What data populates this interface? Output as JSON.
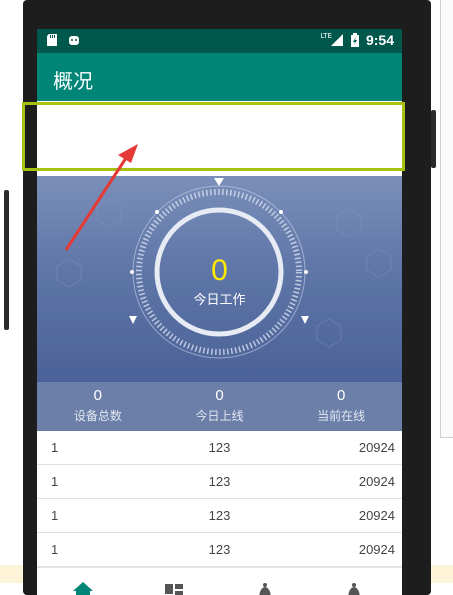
{
  "status_bar": {
    "network": "LTE",
    "time": "9:54"
  },
  "app_bar": {
    "title": "概况"
  },
  "gauge": {
    "value": "0",
    "label": "今日工作"
  },
  "stats": [
    {
      "value": "0",
      "label": "设备总数"
    },
    {
      "value": "0",
      "label": "今日上线"
    },
    {
      "value": "0",
      "label": "当前在线"
    }
  ],
  "rows": [
    {
      "c1": "1",
      "c2": "123",
      "c3": "20924"
    },
    {
      "c1": "1",
      "c2": "123",
      "c3": "20924"
    },
    {
      "c1": "1",
      "c2": "123",
      "c3": "20924"
    },
    {
      "c1": "1",
      "c2": "123",
      "c3": "20924"
    }
  ],
  "bottom_nav": [
    "home-icon",
    "dashboard-icon",
    "bell-icon",
    "bell-icon"
  ],
  "colors": {
    "primary": "#008577",
    "primary_dark": "#00574b",
    "highlight": "#a8c010",
    "arrow": "#e53935",
    "gauge_number": "#ffeb00"
  }
}
